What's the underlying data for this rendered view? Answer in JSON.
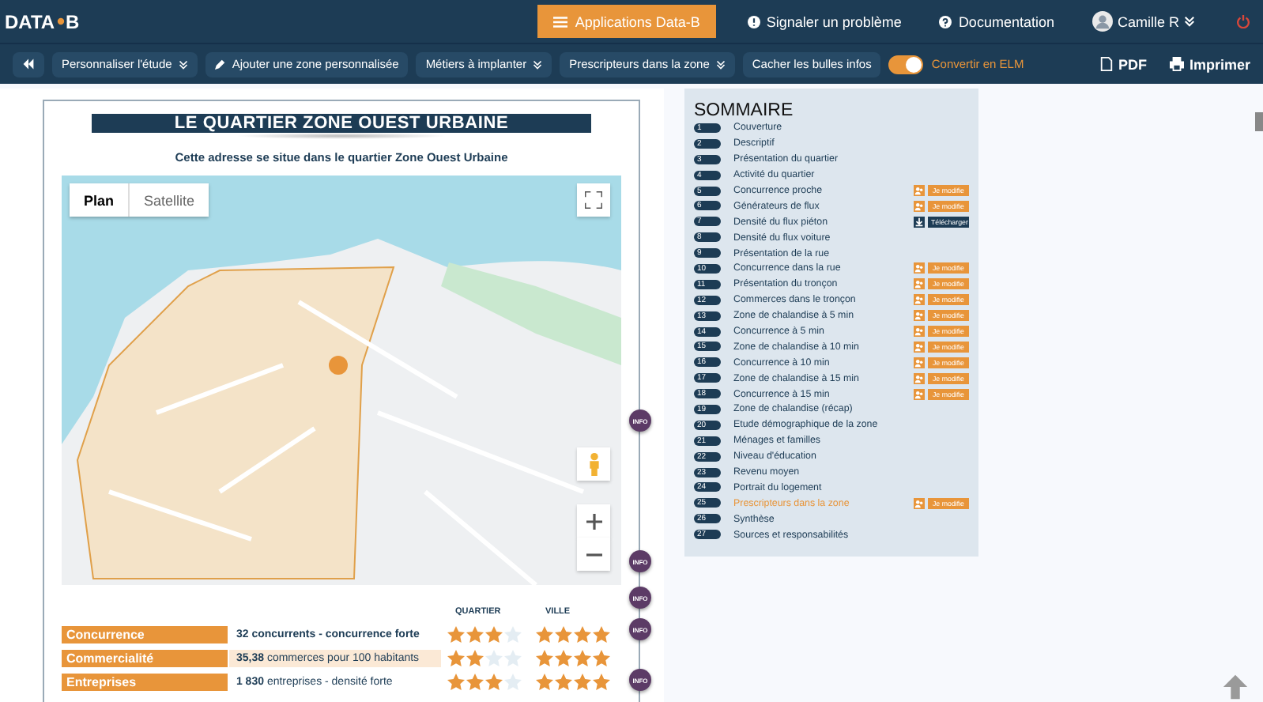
{
  "topbar": {
    "logo": [
      "DATA",
      "B"
    ],
    "apps_button": "Applications Data-B",
    "links": [
      {
        "kind": "alert",
        "label": "Signaler un problème"
      },
      {
        "kind": "help",
        "label": "Documentation"
      }
    ],
    "user": "Camille R"
  },
  "toolbar": {
    "buttons": [
      {
        "kind": "dropdown",
        "label": "Personnaliser l'étude"
      },
      {
        "kind": "edit",
        "label": "Ajouter une zone personnalisée"
      },
      {
        "kind": "dropdown",
        "label": "Métiers à implanter"
      },
      {
        "kind": "dropdown",
        "label": "Prescripteurs dans la zone"
      },
      {
        "kind": "plain",
        "label": "Cacher les bulles infos"
      }
    ],
    "toggle": {
      "on": true,
      "label": "Convertir en ELM"
    },
    "exports": [
      {
        "kind": "pdf",
        "label": "PDF"
      },
      {
        "kind": "print",
        "label": "Imprimer"
      }
    ]
  },
  "page": {
    "title": "LE QUARTIER ZONE OUEST URBAINE",
    "subtitle": "Cette adresse se situe dans le quartier Zone Ouest Urbaine",
    "map_tabs": [
      {
        "label": "Plan",
        "selected": true
      },
      {
        "label": "Satellite",
        "selected": false
      }
    ],
    "info_badges": [
      "INFO",
      "INFO",
      "INFO",
      "INFO",
      "INFO"
    ],
    "columns": [
      "QUARTIER",
      "VILLE"
    ],
    "rows": [
      {
        "label": "Concurrence",
        "value": "**32 concurrents - concurrence forte**",
        "highlight": false,
        "quartier": {
          "stars": 3
        },
        "ville": {
          "stars": 4
        }
      },
      {
        "label": "Commercialité",
        "value": "**35,38** commerces pour 100 habitants",
        "highlight": true,
        "quartier": {
          "stars": 2
        },
        "ville": {
          "stars": 4
        }
      },
      {
        "label": "Entreprises",
        "value": "**1 830** entreprises - densité forte",
        "highlight": false,
        "quartier": {
          "stars": 3
        },
        "ville": {
          "stars": 4
        }
      }
    ]
  },
  "sommaire": {
    "title": "SOMMAIRE",
    "items": [
      {
        "num": "1",
        "label": "Couverture",
        "selected": false
      },
      {
        "num": "2",
        "label": "Descriptif",
        "selected": false
      },
      {
        "num": "3",
        "label": "Présentation du quartier",
        "selected": false
      },
      {
        "num": "4",
        "label": "Activité du quartier",
        "selected": false
      },
      {
        "num": "5",
        "label": "Concurrence proche",
        "selected": false,
        "action": {
          "kind": "edit",
          "label": "Je modifie"
        }
      },
      {
        "num": "6",
        "label": "Générateurs de flux",
        "selected": false,
        "action": {
          "kind": "edit",
          "label": "Je modifie"
        }
      },
      {
        "num": "7",
        "label": "Densité du flux piéton",
        "selected": false,
        "action": {
          "kind": "download",
          "label": "Télécharger"
        }
      },
      {
        "num": "8",
        "label": "Densité du flux voiture",
        "selected": false
      },
      {
        "num": "9",
        "label": "Présentation de la rue",
        "selected": false
      },
      {
        "num": "10",
        "label": "Concurrence dans la rue",
        "selected": false,
        "action": {
          "kind": "edit",
          "label": "Je modifie"
        }
      },
      {
        "num": "11",
        "label": "Présentation du tronçon",
        "selected": false,
        "action": {
          "kind": "edit",
          "label": "Je modifie"
        }
      },
      {
        "num": "12",
        "label": "Commerces dans le tronçon",
        "selected": false,
        "action": {
          "kind": "edit",
          "label": "Je modifie"
        }
      },
      {
        "num": "13",
        "label": "Zone de chalandise à 5 min",
        "selected": false,
        "action": {
          "kind": "edit",
          "label": "Je modifie"
        }
      },
      {
        "num": "14",
        "label": "Concurrence à 5 min",
        "selected": false,
        "action": {
          "kind": "edit",
          "label": "Je modifie"
        }
      },
      {
        "num": "15",
        "label": "Zone de chalandise à 10 min",
        "selected": false,
        "action": {
          "kind": "edit",
          "label": "Je modifie"
        }
      },
      {
        "num": "16",
        "label": "Concurrence à 10 min",
        "selected": false,
        "action": {
          "kind": "edit",
          "label": "Je modifie"
        }
      },
      {
        "num": "17",
        "label": "Zone de chalandise à 15 min",
        "selected": false,
        "action": {
          "kind": "edit",
          "label": "Je modifie"
        }
      },
      {
        "num": "18",
        "label": "Concurrence à 15 min",
        "selected": false,
        "action": {
          "kind": "edit",
          "label": "Je modifie"
        }
      },
      {
        "num": "19",
        "label": "Zone de chalandise (récap)",
        "selected": false
      },
      {
        "num": "20",
        "label": "Etude démographique de la zone",
        "selected": false
      },
      {
        "num": "21",
        "label": "Ménages et familles",
        "selected": false
      },
      {
        "num": "22",
        "label": "Niveau d'éducation",
        "selected": false
      },
      {
        "num": "23",
        "label": "Revenu moyen",
        "selected": false
      },
      {
        "num": "24",
        "label": "Portrait du logement",
        "selected": false
      },
      {
        "num": "25",
        "label": "Prescripteurs dans la zone",
        "selected": true,
        "action": {
          "kind": "edit",
          "label": "Je modifie"
        }
      },
      {
        "num": "26",
        "label": "Synthèse",
        "selected": false
      },
      {
        "num": "27",
        "label": "Sources et responsabilités",
        "selected": false
      }
    ]
  }
}
